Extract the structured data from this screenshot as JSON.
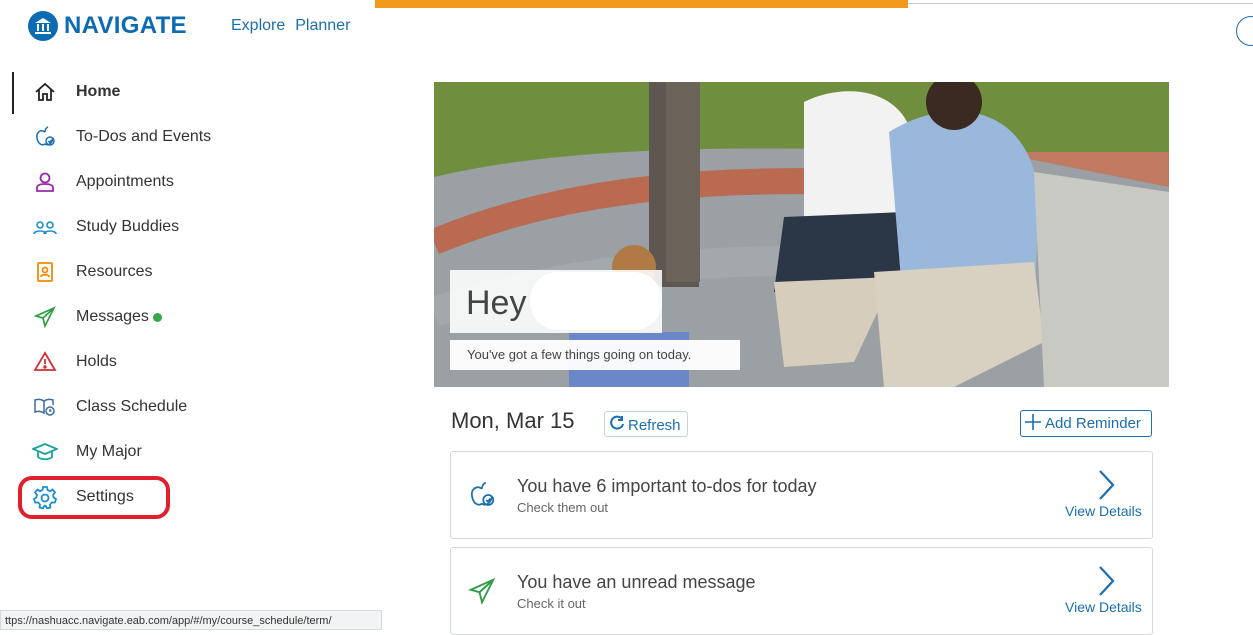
{
  "brand": {
    "name": "NAVIGATE"
  },
  "topnav": {
    "explore": "Explore",
    "planner": "Planner"
  },
  "sidebar": {
    "items": [
      {
        "label": "Home",
        "icon": "home-icon"
      },
      {
        "label": "To-Dos and Events",
        "icon": "todo-apple-icon"
      },
      {
        "label": "Appointments",
        "icon": "person-icon"
      },
      {
        "label": "Study Buddies",
        "icon": "people-icon"
      },
      {
        "label": "Resources",
        "icon": "contact-book-icon"
      },
      {
        "label": "Messages",
        "icon": "paper-plane-icon"
      },
      {
        "label": "Holds",
        "icon": "warning-icon"
      },
      {
        "label": "Class Schedule",
        "icon": "book-clock-icon"
      },
      {
        "label": "My Major",
        "icon": "graduation-cap-icon"
      },
      {
        "label": "Settings",
        "icon": "gear-icon"
      }
    ]
  },
  "hero": {
    "greeting": "Hey",
    "subtitle": "You've got a few things going on today."
  },
  "day": {
    "date": "Mon, Mar 15",
    "refresh_label": "Refresh",
    "add_reminder_label": "Add Reminder"
  },
  "cards": [
    {
      "title": "You have 6 important to-dos for today",
      "subtitle": "Check them out",
      "link": "View Details",
      "icon": "todo-apple-icon"
    },
    {
      "title": "You have an unread message",
      "subtitle": "Check it out",
      "link": "View Details",
      "icon": "paper-plane-icon"
    }
  ],
  "status_bar": {
    "url": "ttps://nashuacc.navigate.eab.com/app/#/my/course_schedule/term/"
  },
  "colors": {
    "brand_blue": "#0b6bb3",
    "accent_orange": "#f29a1c",
    "highlight_red": "#e0202c",
    "online_green": "#37a84a"
  }
}
